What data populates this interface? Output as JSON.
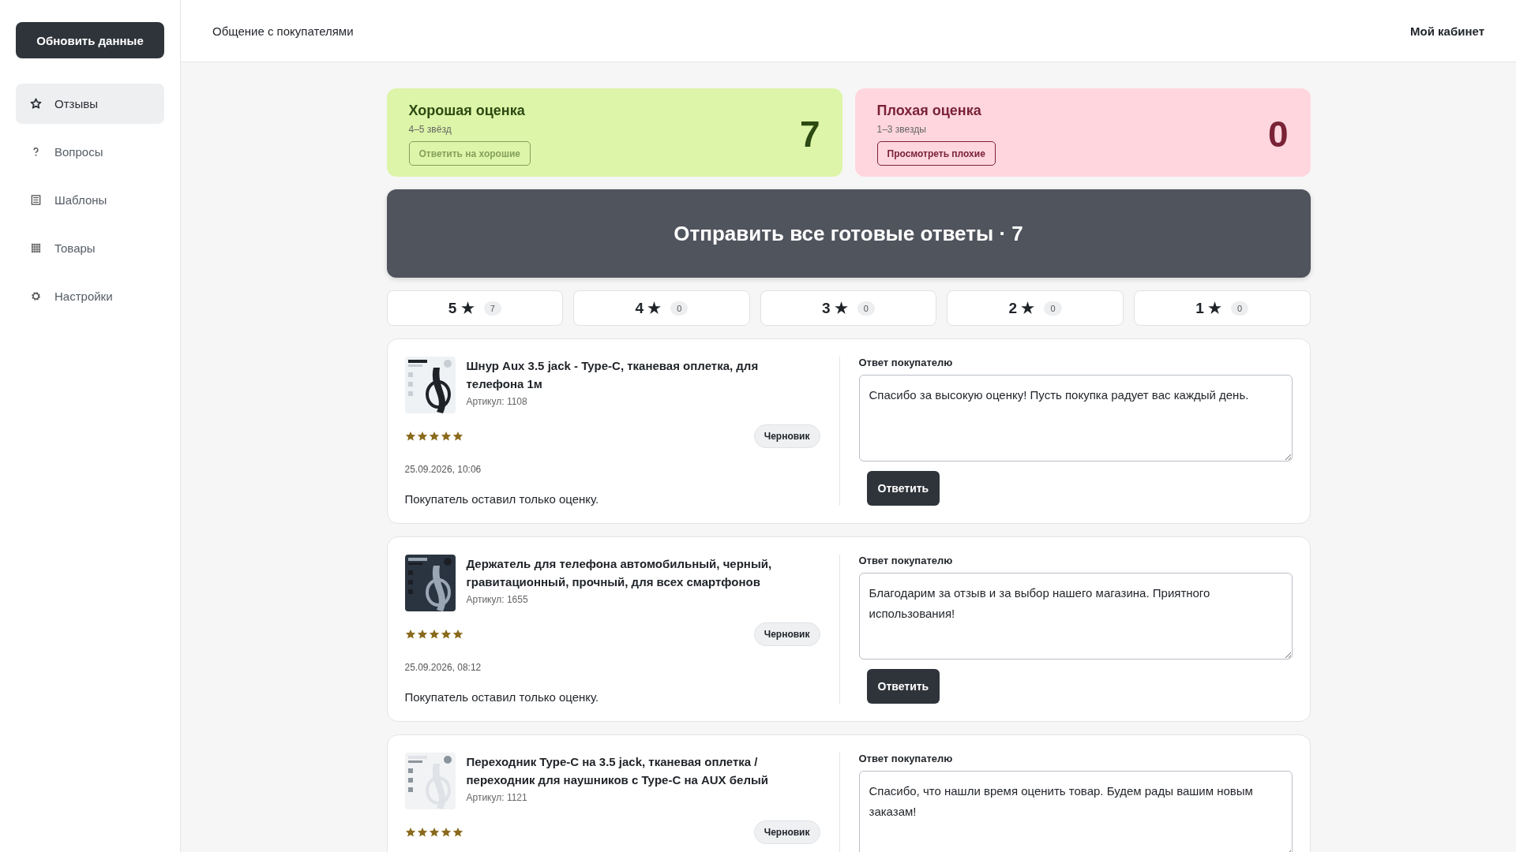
{
  "sidebar": {
    "refresh_button": "Обновить данные",
    "items": [
      {
        "label": "Отзывы",
        "selected": true
      },
      {
        "label": "Вопросы",
        "selected": false
      },
      {
        "label": "Шаблоны",
        "selected": false
      },
      {
        "label": "Товары",
        "selected": false
      },
      {
        "label": "Настройки",
        "selected": false
      }
    ]
  },
  "header": {
    "title": "Общение с покупателями",
    "account": "Мой кабинет"
  },
  "summary_cards": [
    {
      "kind": "good",
      "title": "Хорошая оценка",
      "subtitle": "4–5 звёзд",
      "count": "7",
      "button": "Ответить на хорошие",
      "button_disabled": true
    },
    {
      "kind": "bad",
      "title": "Плохая оценка",
      "subtitle": "1–3 звезды",
      "count": "0",
      "button": "Просмотреть плохие",
      "button_disabled": false
    }
  ],
  "send_all_button": "Отправить все готовые ответы · 7",
  "rating_tabs": [
    {
      "label": "5 ★",
      "count": "7",
      "selected": false
    },
    {
      "label": "4 ★",
      "count": "0",
      "selected": false
    },
    {
      "label": "3 ★",
      "count": "0",
      "selected": false
    },
    {
      "label": "2 ★",
      "count": "0",
      "selected": false
    },
    {
      "label": "1 ★",
      "count": "0",
      "selected": false
    }
  ],
  "reviews": [
    {
      "product": "Шнур Aux 3.5 jack - Type-C, тканевая оплетка, для телефона 1м",
      "article": "Артикул: 1108",
      "stars": 5,
      "status": "Черновик",
      "date": "25.09.2026, 10:06",
      "text": "Покупатель оставил только оценку.",
      "reply_label": "Ответ покупателю",
      "reply": "Спасибо за высокую оценку! Пусть покупка радует вас каждый день.",
      "reply_button": "Ответить"
    },
    {
      "product": "Держатель для телефона автомобильный, черный, гравитационный, прочный, для всех смартфонов",
      "article": "Артикул: 1655",
      "stars": 5,
      "status": "Черновик",
      "date": "25.09.2026, 08:12",
      "text": "Покупатель оставил только оценку.",
      "reply_label": "Ответ покупателю",
      "reply": "Благодарим за отзыв и за выбор нашего магазина. Приятного использования!",
      "reply_button": "Ответить"
    },
    {
      "product": "Переходник Type-C на 3.5 jack, тканевая оплетка / переходник для наушников с Type-C на AUX белый",
      "article": "Артикул: 1121",
      "stars": 5,
      "status": "Черновик",
      "reply_label": "Ответ покупателю",
      "reply": "Спасибо, что нашли время оценить товар. Будем рады вашим новым заказам!"
    }
  ]
}
